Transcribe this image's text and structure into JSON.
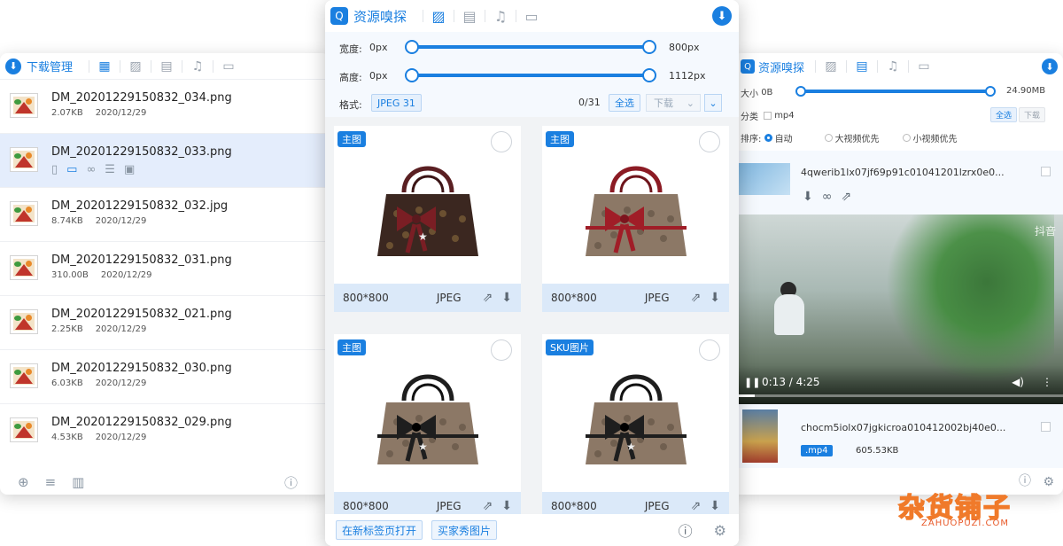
{
  "left_panel": {
    "title": "下载管理",
    "files": [
      {
        "name": "DM_20201229150832_034.png",
        "size": "2.07KB",
        "date": "2020/12/29"
      },
      {
        "name": "DM_20201229150832_033.png",
        "size": "",
        "date": ""
      },
      {
        "name": "DM_20201229150832_032.jpg",
        "size": "8.74KB",
        "date": "2020/12/29"
      },
      {
        "name": "DM_20201229150832_031.png",
        "size": "310.00B",
        "date": "2020/12/29"
      },
      {
        "name": "DM_20201229150832_021.png",
        "size": "2.25KB",
        "date": "2020/12/29"
      },
      {
        "name": "DM_20201229150832_030.png",
        "size": "6.03KB",
        "date": "2020/12/29"
      },
      {
        "name": "DM_20201229150832_029.png",
        "size": "4.53KB",
        "date": "2020/12/29"
      }
    ]
  },
  "center_panel": {
    "title": "资源嗅探",
    "width_label": "宽度:",
    "width_min": "0px",
    "width_max": "800px",
    "height_label": "高度:",
    "height_min": "0px",
    "height_max": "1112px",
    "format_label": "格式:",
    "format_chip": "JPEG  31",
    "count": "0/31",
    "select_all": "全选",
    "download": "下载",
    "cards": [
      {
        "tag": "主图",
        "size": "800*800",
        "fmt": "JPEG"
      },
      {
        "tag": "主图",
        "size": "800*800",
        "fmt": "JPEG"
      },
      {
        "tag": "主图",
        "size": "800*800",
        "fmt": "JPEG"
      },
      {
        "tag": "SKU图片",
        "size": "800*800",
        "fmt": "JPEG"
      }
    ],
    "open_new_tab": "在新标签页打开",
    "buyer_show": "买家秀图片"
  },
  "right_panel": {
    "title": "资源嗅探",
    "size_label": "大小",
    "size_min": "0B",
    "size_max": "24.90MB",
    "category_label": "分类",
    "category_value": "mp4",
    "select_all": "全选",
    "download": "下载",
    "sort_label": "排序:",
    "sort_options": [
      "自动",
      "大视频优先",
      "小视频优先"
    ],
    "video1_name": "4qwerib1lx07jf69p91c01041201lzrx0e0...",
    "video_time": "0:13 / 4:25",
    "video_watermark": "抖音",
    "video2_name": "chocm5iolx07jgkicroa010412002bj40e0...",
    "video2_format": ".mp4",
    "video2_size": "605.53KB"
  },
  "watermark": {
    "zh": "杂货铺子",
    "en": "ZAHUOPUZI.COM"
  }
}
